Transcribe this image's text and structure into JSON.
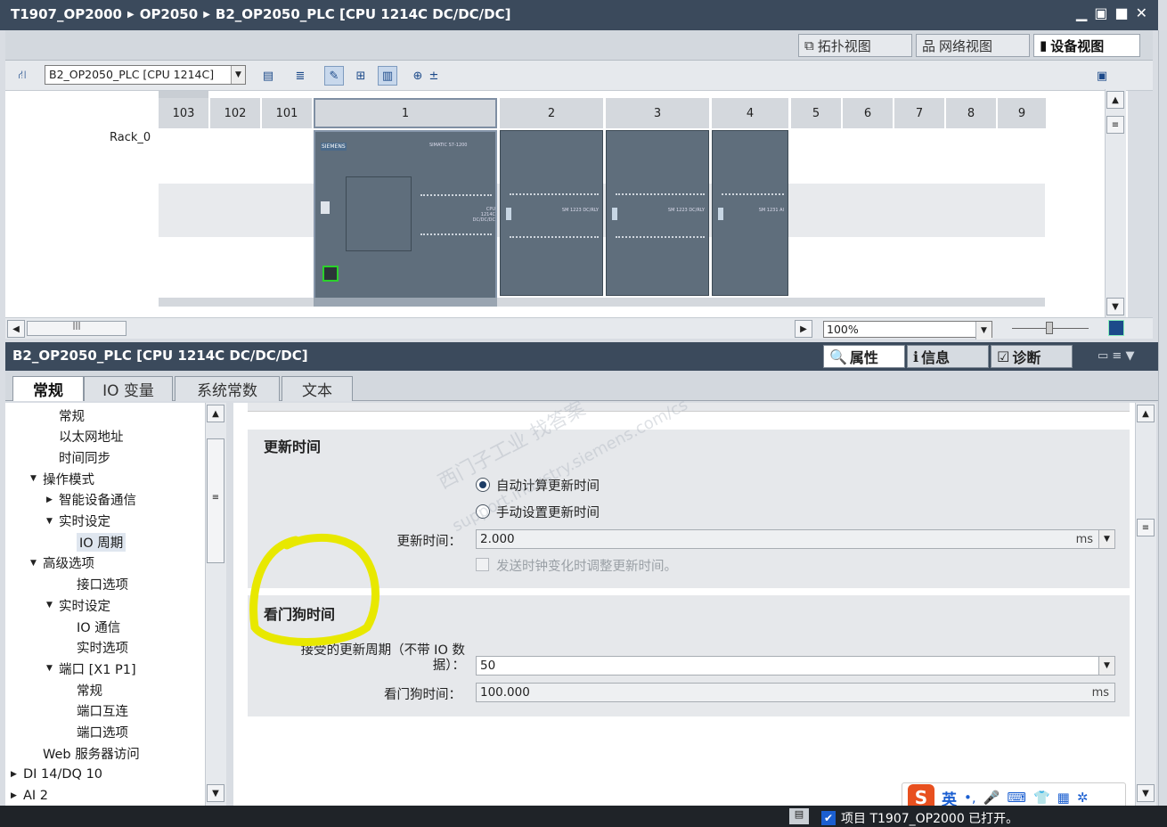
{
  "titlebar": {
    "crumbs": [
      "T1907_OP2000",
      "OP2050",
      "B2_OP2050_PLC [CPU 1214C DC/DC/DC]"
    ],
    "controls": [
      "▁",
      "▣",
      "■",
      "✕"
    ]
  },
  "view_tabs": {
    "topology": "拓扑视图",
    "network": "网络视图",
    "device": "设备视图"
  },
  "toolbar": {
    "device_select": "B2_OP2050_PLC [CPU 1214C]"
  },
  "rack": {
    "name": "Rack_0",
    "slots": [
      "103",
      "102",
      "101",
      "1",
      "2",
      "3",
      "4",
      "5",
      "6",
      "7",
      "8",
      "9"
    ],
    "modules": {
      "cpu_brand": "SIEMENS",
      "cpu_series": "SIMATIC S7-1200",
      "cpu_type": "CPU 1214C DC/DC/DC",
      "sm2": "SM 1223 DC/RLY",
      "sm3": "SM 1223 DC/RLY",
      "sm4": "SM 1231 AI"
    }
  },
  "zoom": "100%",
  "properties": {
    "title": "B2_OP2050_PLC [CPU 1214C DC/DC/DC]",
    "tabs": [
      "属性",
      "信息",
      "诊断"
    ],
    "subtabs": [
      "常规",
      "IO 变量",
      "系统常数",
      "文本"
    ]
  },
  "nav": [
    {
      "label": "常规",
      "level": 2
    },
    {
      "label": "以太网地址",
      "level": 2
    },
    {
      "label": "时间同步",
      "level": 2
    },
    {
      "label": "操作模式",
      "level": 1,
      "expand": "open"
    },
    {
      "label": "智能设备通信",
      "level": 2,
      "expand": "closed"
    },
    {
      "label": "实时设定",
      "level": 2,
      "expand": "open"
    },
    {
      "label": "IO 周期",
      "level": 3,
      "selected": true
    },
    {
      "label": "高级选项",
      "level": 1,
      "expand": "open"
    },
    {
      "label": "接口选项",
      "level": 3
    },
    {
      "label": "实时设定",
      "level": 2,
      "expand": "open"
    },
    {
      "label": "IO 通信",
      "level": 3
    },
    {
      "label": "实时选项",
      "level": 3
    },
    {
      "label": "端口 [X1 P1]",
      "level": 2,
      "expand": "open"
    },
    {
      "label": "常规",
      "level": 3
    },
    {
      "label": "端口互连",
      "level": 3
    },
    {
      "label": "端口选项",
      "level": 3
    },
    {
      "label": "Web 服务器访问",
      "level": 1
    },
    {
      "label": "DI 14/DQ 10",
      "level": 0,
      "expand": "closed"
    },
    {
      "label": "AI 2",
      "level": 0,
      "expand": "closed"
    }
  ],
  "update_time": {
    "title": "更新时间",
    "radio_auto": "自动计算更新时间",
    "radio_manual": "手动设置更新时间",
    "field_label": "更新时间：",
    "field_value": "2.000",
    "field_unit": "ms",
    "checkbox_label": "发送时钟变化时调整更新时间。"
  },
  "watchdog": {
    "title": "看门狗时间",
    "cycles_label_line1": "接受的更新周期（不带 IO 数",
    "cycles_label_line2": "据）：",
    "cycles_value": "50",
    "time_label": "看门狗时间：",
    "time_value": "100.000",
    "time_unit": "ms"
  },
  "status": {
    "text": "项目 T1907_OP2000 已打开。"
  },
  "ime": {
    "lang": "英"
  },
  "watermark": {
    "line1": "西门子工业  找答案",
    "line2": "support.industry.siemens.com/cs"
  },
  "colors": {
    "titlebar": "#3b4a5c",
    "module": "#5f6e7c",
    "highlight": "#e8e800"
  }
}
